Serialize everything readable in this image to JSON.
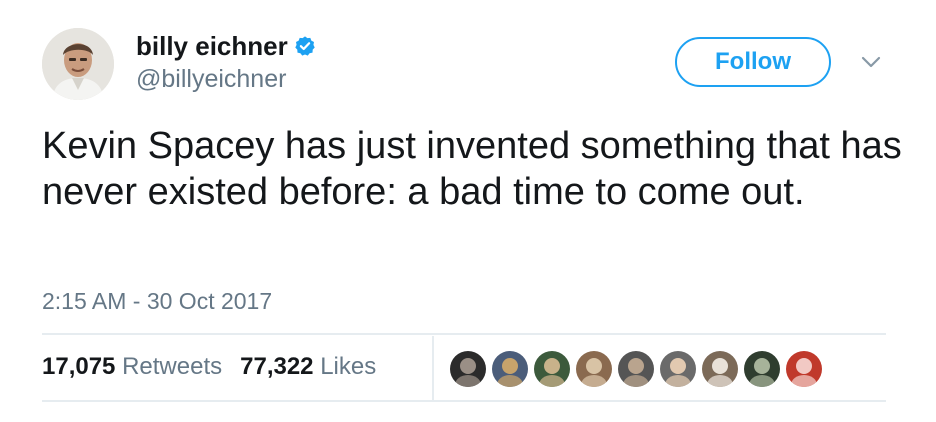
{
  "author": {
    "display_name": "billy eichner",
    "handle": "@billyeichner",
    "avatar_icon": "profile-avatar",
    "verified_icon": "verified-badge-icon"
  },
  "actions": {
    "follow_label": "Follow",
    "more_icon": "chevron-down-icon"
  },
  "tweet": {
    "text": "Kevin Spacey has just invented something that has never existed before: a bad time to come out.",
    "timestamp": "2:15 AM - 30 Oct 2017"
  },
  "stats": {
    "retweets_count": "17,075",
    "retweets_label": "Retweets",
    "likes_count": "77,322",
    "likes_label": "Likes"
  },
  "colors": {
    "accent": "#1da1f2",
    "muted": "#657786",
    "text": "#14171a",
    "divider": "#e6ecf0"
  },
  "liker_avatars": [
    {
      "icon": "liker-avatar-1",
      "colors": [
        "#2b2b2b",
        "#9a8f86"
      ]
    },
    {
      "icon": "liker-avatar-2",
      "colors": [
        "#4b5d7a",
        "#c7a36b"
      ]
    },
    {
      "icon": "liker-avatar-3",
      "colors": [
        "#3c5a3c",
        "#c8b28a"
      ]
    },
    {
      "icon": "liker-avatar-4",
      "colors": [
        "#8a6a4f",
        "#d8c3a5"
      ]
    },
    {
      "icon": "liker-avatar-5",
      "colors": [
        "#555555",
        "#b9a48e"
      ]
    },
    {
      "icon": "liker-avatar-6",
      "colors": [
        "#6a6a6a",
        "#e2c9b0"
      ]
    },
    {
      "icon": "liker-avatar-7",
      "colors": [
        "#7c6a58",
        "#e9e2d8"
      ]
    },
    {
      "icon": "liker-avatar-8",
      "colors": [
        "#2f3d2f",
        "#a7b39a"
      ]
    },
    {
      "icon": "liker-avatar-9",
      "colors": [
        "#c0392b",
        "#f2c9c4"
      ]
    }
  ]
}
